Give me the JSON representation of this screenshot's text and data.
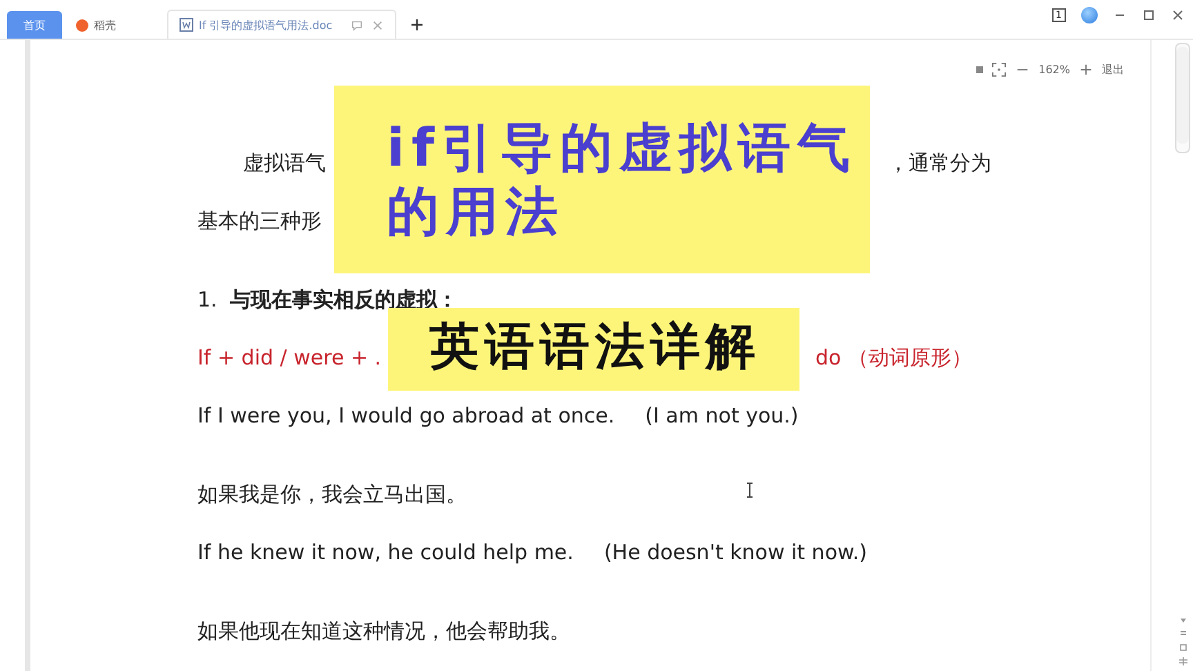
{
  "tabs": [
    {
      "kind": "home",
      "label": "首页",
      "selected": false
    },
    {
      "kind": "app",
      "label": "稻壳",
      "selected": false
    },
    {
      "kind": "doc",
      "label": "If 引导的虚拟语气用法.doc",
      "selected": true
    }
  ],
  "window_badge": "1",
  "zoom_bar": {
    "percent": "162%",
    "exit": "退出"
  },
  "document": {
    "lines": [
      {
        "kind": "intro",
        "left": "虚拟语气",
        "right": "，通常分为"
      },
      {
        "kind": "plain",
        "left": "基本的三种形"
      },
      {
        "kind": "heading",
        "number": "1.",
        "left": "与现在事实相反的虚拟："
      },
      {
        "kind": "formula",
        "left": "If + did / were + .",
        "right": "do （动词原形）"
      },
      {
        "kind": "example",
        "left": "If I were you, I would go abroad at once.",
        "right": "(I am not you.)"
      },
      {
        "kind": "translation",
        "left": "如果我是你，我会立马出国。"
      },
      {
        "kind": "example",
        "left": "If he knew it now, he could help me.",
        "right": "(He doesn't know it now.)"
      },
      {
        "kind": "translation",
        "left": "如果他现在知道这种情况，他会帮助我。"
      }
    ]
  },
  "banners": [
    {
      "kind": "title",
      "lines": [
        "if引导的虚拟语气",
        "的用法"
      ]
    },
    {
      "kind": "subtitle",
      "lines": [
        "英语语法详解"
      ]
    }
  ]
}
